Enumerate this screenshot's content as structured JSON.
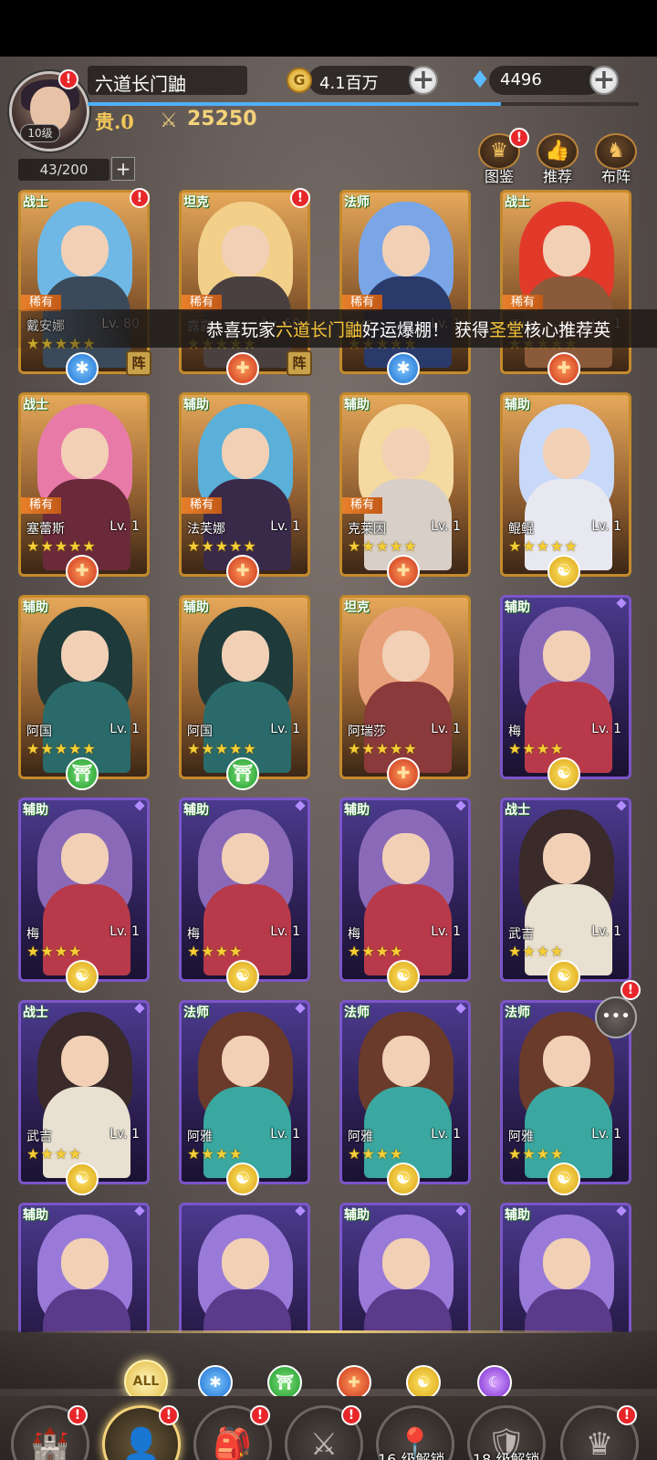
{
  "player": {
    "name": "六道长门鼬",
    "level": "10级",
    "vip": "贵.0",
    "power": "25250",
    "gold": "4.1百万",
    "diamonds": "4496",
    "hero_count": "43/200"
  },
  "icons": {
    "coin": "G",
    "plus": "+",
    "swords": "⚔",
    "gem": "♦",
    "badge": "!"
  },
  "top_buttons": [
    {
      "label": "图鉴",
      "icon": "crown-icon",
      "glyph": "♛"
    },
    {
      "label": "推荐",
      "icon": "thumb-icon",
      "glyph": "👍"
    },
    {
      "label": "布阵",
      "icon": "horse-icon",
      "glyph": "♞"
    }
  ],
  "marquee": {
    "prefix": "恭喜玩家",
    "player": "六道长门鼬",
    "middle": "好运爆棚！ 获得",
    "faction": "圣堂",
    "suffix": "核心推荐英"
  },
  "heroes": [
    {
      "role": "战士",
      "rare": "稀有",
      "name": "戴安娜",
      "lv": "Lv. 80",
      "stars": "★★★★★",
      "faction": "lianbang",
      "fglyph": "✱",
      "zhen": "阵",
      "red_dot": true,
      "frame": "gold",
      "hair": "#6fb8e6",
      "bodyc": "#3a4a5a"
    },
    {
      "role": "坦克",
      "rare": "稀有",
      "name": "露露",
      "lv": "Lv. 60",
      "stars": "★★★★★",
      "faction": "shengtang",
      "fglyph": "✚",
      "zhen": "阵",
      "red_dot": true,
      "frame": "gold",
      "hair": "#f2d08a",
      "bodyc": "#4a4040"
    },
    {
      "role": "法师",
      "rare": "稀有",
      "name": "乔伊",
      "lv": "Lv. 1",
      "stars": "★★★★★",
      "faction": "lianbang",
      "fglyph": "✱",
      "frame": "gold",
      "hair": "#7aa6e8",
      "bodyc": "#2a3a6a"
    },
    {
      "role": "战士",
      "rare": "稀有",
      "name": "桑娅",
      "lv": "Lv. 1",
      "stars": "★★★★★",
      "faction": "shengtang",
      "fglyph": "✚",
      "frame": "gold",
      "hair": "#e23a2a",
      "bodyc": "#8a5a3a"
    },
    {
      "role": "战士",
      "rare": "稀有",
      "name": "塞蕾斯",
      "lv": "Lv. 1",
      "stars": "★★★★★",
      "faction": "shengtang",
      "fglyph": "✚",
      "frame": "gold",
      "hair": "#e87aa8",
      "bodyc": "#6a2a3a"
    },
    {
      "role": "辅助",
      "rare": "稀有",
      "name": "法芙娜",
      "lv": "Lv. 1",
      "stars": "★★★★★",
      "faction": "shengtang",
      "fglyph": "✚",
      "frame": "gold",
      "hair": "#5ab0d8",
      "bodyc": "#3a2a4a"
    },
    {
      "role": "辅助",
      "rare": "稀有",
      "name": "克莱因",
      "lv": "Lv. 1",
      "stars": "★★★★★",
      "faction": "shengtang",
      "fglyph": "✚",
      "frame": "gold",
      "hair": "#f4d9a0",
      "bodyc": "#d8d0c8"
    },
    {
      "role": "辅助",
      "name": "鲲鲲",
      "lv": "Lv. 1",
      "stars": "★★★★★",
      "faction": "huaxia",
      "fglyph": "☯",
      "frame": "gold",
      "hair": "#c8d8f8",
      "bodyc": "#e8e8f0"
    },
    {
      "role": "辅助",
      "name": "阿国",
      "lv": "Lv. 1",
      "stars": "★★★★★",
      "faction": "chuyun",
      "fglyph": "⛩",
      "frame": "gold",
      "hair": "#1e3a3a",
      "bodyc": "#2a6a6a"
    },
    {
      "role": "辅助",
      "name": "阿国",
      "lv": "Lv. 1",
      "stars": "★★★★★",
      "faction": "chuyun",
      "fglyph": "⛩",
      "frame": "gold",
      "hair": "#1e3a3a",
      "bodyc": "#2a6a6a"
    },
    {
      "role": "坦克",
      "name": "阿瑞莎",
      "lv": "Lv. 1",
      "stars": "★★★★★",
      "faction": "shengtang",
      "fglyph": "✚",
      "frame": "gold",
      "hair": "#e8a07a",
      "bodyc": "#8a3a3a"
    },
    {
      "role": "辅助",
      "name": "梅",
      "lv": "Lv. 1",
      "stars": "★★★★",
      "faction": "huaxia",
      "fglyph": "☯",
      "frame": "purple",
      "hair": "#8a6ab8",
      "bodyc": "#b83a4a"
    },
    {
      "role": "辅助",
      "name": "梅",
      "lv": "Lv. 1",
      "stars": "★★★★",
      "faction": "huaxia",
      "fglyph": "☯",
      "frame": "purple",
      "hair": "#8a6ab8",
      "bodyc": "#b83a4a"
    },
    {
      "role": "辅助",
      "name": "梅",
      "lv": "Lv. 1",
      "stars": "★★★★",
      "faction": "huaxia",
      "fglyph": "☯",
      "frame": "purple",
      "hair": "#8a6ab8",
      "bodyc": "#b83a4a"
    },
    {
      "role": "辅助",
      "name": "梅",
      "lv": "Lv. 1",
      "stars": "★★★★",
      "faction": "huaxia",
      "fglyph": "☯",
      "frame": "purple",
      "hair": "#8a6ab8",
      "bodyc": "#b83a4a"
    },
    {
      "role": "战士",
      "name": "武吉",
      "lv": "Lv. 1",
      "stars": "★★★★",
      "faction": "huaxia",
      "fglyph": "☯",
      "frame": "purple",
      "hair": "#3a2a2a",
      "bodyc": "#e8e0d0"
    },
    {
      "role": "战士",
      "name": "武吉",
      "lv": "Lv. 1",
      "stars": "★★★★",
      "faction": "huaxia",
      "fglyph": "☯",
      "frame": "purple",
      "hair": "#3a2a2a",
      "bodyc": "#e8e0d0"
    },
    {
      "role": "法师",
      "name": "阿雅",
      "lv": "Lv. 1",
      "stars": "★★★★",
      "faction": "huaxia",
      "fglyph": "☯",
      "frame": "purple",
      "hair": "#6a3a2a",
      "bodyc": "#3aa8a0"
    },
    {
      "role": "法师",
      "name": "阿雅",
      "lv": "Lv. 1",
      "stars": "★★★★",
      "faction": "huaxia",
      "fglyph": "☯",
      "frame": "purple",
      "hair": "#6a3a2a",
      "bodyc": "#3aa8a0"
    },
    {
      "role": "法师",
      "name": "阿雅",
      "lv": "Lv. 1",
      "stars": "★★★★",
      "faction": "huaxia",
      "fglyph": "☯",
      "frame": "purple",
      "hair": "#6a3a2a",
      "bodyc": "#3aa8a0"
    },
    {
      "role": "辅助",
      "name": "",
      "lv": "",
      "stars": "",
      "frame": "purple",
      "hair": "#9a7ad8",
      "bodyc": "#5a3a8a"
    },
    {
      "role": "",
      "name": "",
      "lv": "",
      "stars": "",
      "frame": "purple",
      "hair": "#9a7ad8",
      "bodyc": "#5a3a8a"
    },
    {
      "role": "辅助",
      "name": "",
      "lv": "",
      "stars": "",
      "frame": "purple",
      "hair": "#9a7ad8",
      "bodyc": "#5a3a8a"
    },
    {
      "role": "辅助",
      "name": "",
      "lv": "",
      "stars": "",
      "frame": "purple",
      "hair": "#9a7ad8",
      "bodyc": "#5a3a8a"
    }
  ],
  "filters": [
    {
      "label": "全部",
      "glyph": "ALL",
      "cls": "all"
    },
    {
      "label": "联邦",
      "glyph": "✱",
      "cls": "f-lianbang"
    },
    {
      "label": "出云",
      "glyph": "⛩",
      "cls": "f-chuyun"
    },
    {
      "label": "圣堂",
      "glyph": "✚",
      "cls": "f-shengtang"
    },
    {
      "label": "华夏",
      "glyph": "☯",
      "cls": "f-huaxia"
    },
    {
      "label": "暗夜",
      "glyph": "☾",
      "cls": "f-anye"
    }
  ],
  "nav": [
    {
      "label": "主城",
      "glyph": "🏰",
      "badge": true
    },
    {
      "label": "英雄",
      "glyph": "👤",
      "badge": true,
      "active": true
    },
    {
      "label": "背包",
      "glyph": "🎒",
      "badge": true
    },
    {
      "label": "战斗",
      "glyph": "⚔",
      "badge": true
    },
    {
      "label": "历练",
      "glyph": "📍"
    },
    {
      "label": "公会",
      "glyph": "🛡"
    },
    {
      "label": "女神",
      "glyph": "♛",
      "badge": true
    }
  ],
  "locks": {
    "lilian": "16 级解锁",
    "gonghui": "18 级解锁"
  },
  "chat": {
    "glyph": "•••"
  },
  "sys": {
    "menu": "≡",
    "home": "⌂",
    "back": "⮌"
  }
}
